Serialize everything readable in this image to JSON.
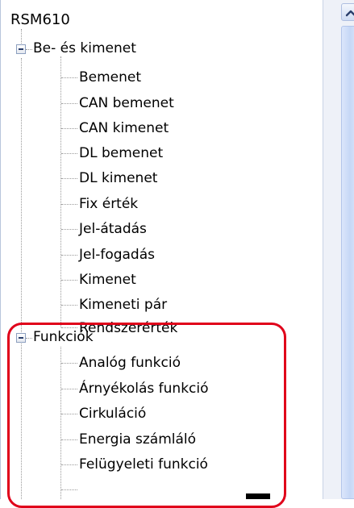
{
  "tree": {
    "root": "RSM610",
    "groups": [
      {
        "label": "Be- és kimenet",
        "expanded": true,
        "children": [
          "Bemenet",
          "CAN bemenet",
          "CAN kimenet",
          "DL bemenet",
          "DL kimenet",
          "Fix érték",
          "Jel-átadás",
          "Jel-fogadás",
          "Kimenet",
          "Kimeneti pár",
          "Rendszerérték"
        ]
      },
      {
        "label": "Funkciók",
        "expanded": true,
        "children": [
          "Analóg funkció",
          "Árnyékolás funkció",
          "Cirkuláció",
          "Energia számláló",
          "Felügyeleti funkció"
        ]
      }
    ]
  },
  "icons": {
    "expander": "minus-box-icon",
    "scroll_up": "chevron-up-icon"
  },
  "colors": {
    "highlight": "#e0001a",
    "scroll_track": "#eef1f8",
    "scroll_thumb": "#c6d7f6",
    "tree_line": "#9a9a9a"
  }
}
